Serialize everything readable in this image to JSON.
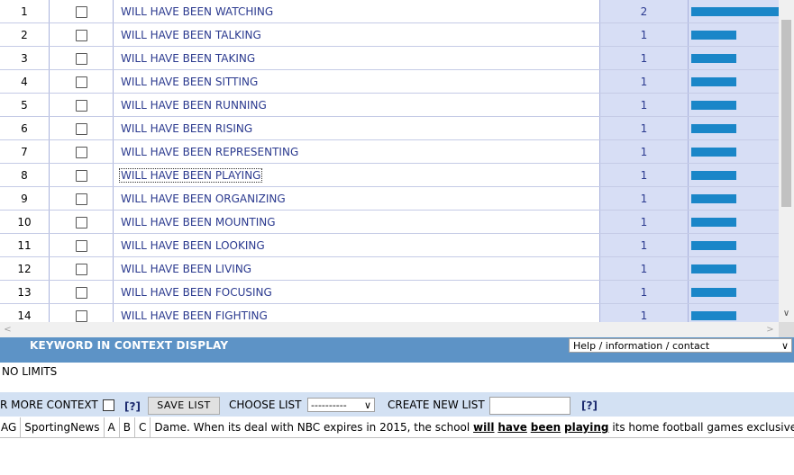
{
  "results": [
    {
      "n": "1",
      "text": "WILL HAVE BEEN WATCHING",
      "freq": "2",
      "bar": 1.0
    },
    {
      "n": "2",
      "text": "WILL HAVE BEEN TALKING",
      "freq": "1",
      "bar": 0.5
    },
    {
      "n": "3",
      "text": "WILL HAVE BEEN TAKING",
      "freq": "1",
      "bar": 0.5
    },
    {
      "n": "4",
      "text": "WILL HAVE BEEN SITTING",
      "freq": "1",
      "bar": 0.5
    },
    {
      "n": "5",
      "text": "WILL HAVE BEEN RUNNING",
      "freq": "1",
      "bar": 0.5
    },
    {
      "n": "6",
      "text": "WILL HAVE BEEN RISING",
      "freq": "1",
      "bar": 0.5
    },
    {
      "n": "7",
      "text": "WILL HAVE BEEN REPRESENTING",
      "freq": "1",
      "bar": 0.5
    },
    {
      "n": "8",
      "text": "WILL HAVE BEEN PLAYING",
      "freq": "1",
      "bar": 0.5,
      "focused": true
    },
    {
      "n": "9",
      "text": "WILL HAVE BEEN ORGANIZING",
      "freq": "1",
      "bar": 0.5
    },
    {
      "n": "10",
      "text": "WILL HAVE BEEN MOUNTING",
      "freq": "1",
      "bar": 0.5
    },
    {
      "n": "11",
      "text": "WILL HAVE BEEN LOOKING",
      "freq": "1",
      "bar": 0.5
    },
    {
      "n": "12",
      "text": "WILL HAVE BEEN LIVING",
      "freq": "1",
      "bar": 0.5
    },
    {
      "n": "13",
      "text": "WILL HAVE BEEN FOCUSING",
      "freq": "1",
      "bar": 0.5
    },
    {
      "n": "14",
      "text": "WILL HAVE BEEN FIGHTING",
      "freq": "1",
      "bar": 0.5
    }
  ],
  "kwic": {
    "title": "KEYWORD IN CONTEXT DISPLAY",
    "help_select": "Help / information / contact"
  },
  "limits": "NO LIMITS",
  "controls": {
    "more_context": "R MORE CONTEXT",
    "help": "[?]",
    "save_list": "SAVE LIST",
    "choose_list": "CHOOSE LIST",
    "choose_value": "----------",
    "create_new_list": "CREATE NEW LIST",
    "help2": "[?]"
  },
  "concordance": {
    "genre": "AG",
    "source": "SportingNews",
    "a": "A",
    "b": "B",
    "c": "C",
    "before": "Dame. When its deal with NBC expires in 2015, the school ",
    "kw1": "will",
    "kw2": "have",
    "kw3": "been",
    "kw4": "playing",
    "after": " its home football games exclusively on n"
  },
  "colors": {
    "bar": "#1a86c8",
    "header_bar": "#5d93c6",
    "controls_bar": "#d3e1f3",
    "freq_column": "#d7def5"
  }
}
